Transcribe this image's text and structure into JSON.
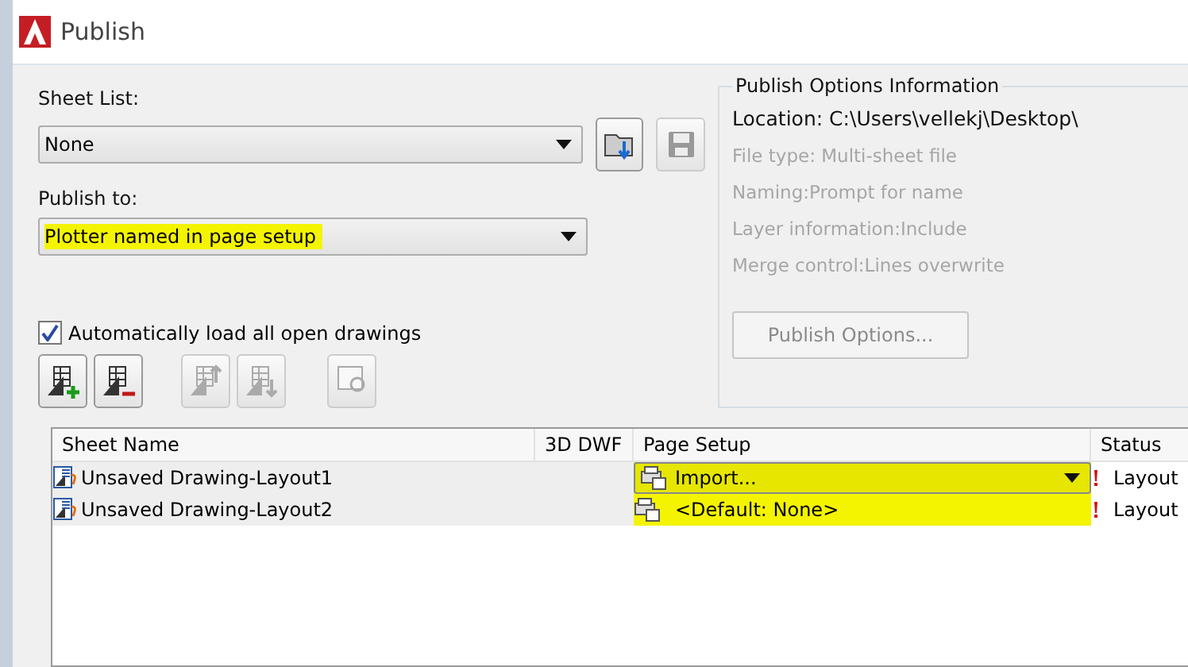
{
  "window": {
    "title": "Publish"
  },
  "sheet_list": {
    "label": "Sheet List:",
    "value": "None"
  },
  "publish_to": {
    "label": "Publish to:",
    "value": "Plotter named in page setup",
    "highlighted": true
  },
  "options_info": {
    "title": "Publish Options Information",
    "lines": [
      {
        "text": "Location: C:\\Users\\vellekj\\Desktop\\",
        "disabled": false
      },
      {
        "text": "File type: Multi-sheet file",
        "disabled": true
      },
      {
        "text": "Naming:Prompt for name",
        "disabled": true
      },
      {
        "text": "Layer information:Include",
        "disabled": true
      },
      {
        "text": "Merge control:Lines overwrite",
        "disabled": true
      }
    ],
    "button": {
      "label": "Publish Options...",
      "disabled": true
    }
  },
  "auto_load": {
    "label": "Automatically load all open drawings",
    "checked": true
  },
  "toolbar": [
    {
      "kind": "add",
      "disabled": false
    },
    {
      "kind": "remove",
      "disabled": false
    },
    {
      "kind": "up",
      "disabled": true
    },
    {
      "kind": "down",
      "disabled": true
    },
    {
      "kind": "preview",
      "disabled": true
    }
  ],
  "table": {
    "columns": [
      "Sheet Name",
      "3D DWF",
      "Page Setup",
      "Status"
    ],
    "rows": [
      {
        "sheet_name": "Unsaved Drawing-Layout1",
        "page_setup": "Import...",
        "kind": "dropdown",
        "status": "Layout",
        "highlighted": true
      },
      {
        "sheet_name": "Unsaved Drawing-Layout2",
        "page_setup": "<Default: None>",
        "kind": "text",
        "status": "Layout",
        "highlighted": true
      }
    ]
  }
}
